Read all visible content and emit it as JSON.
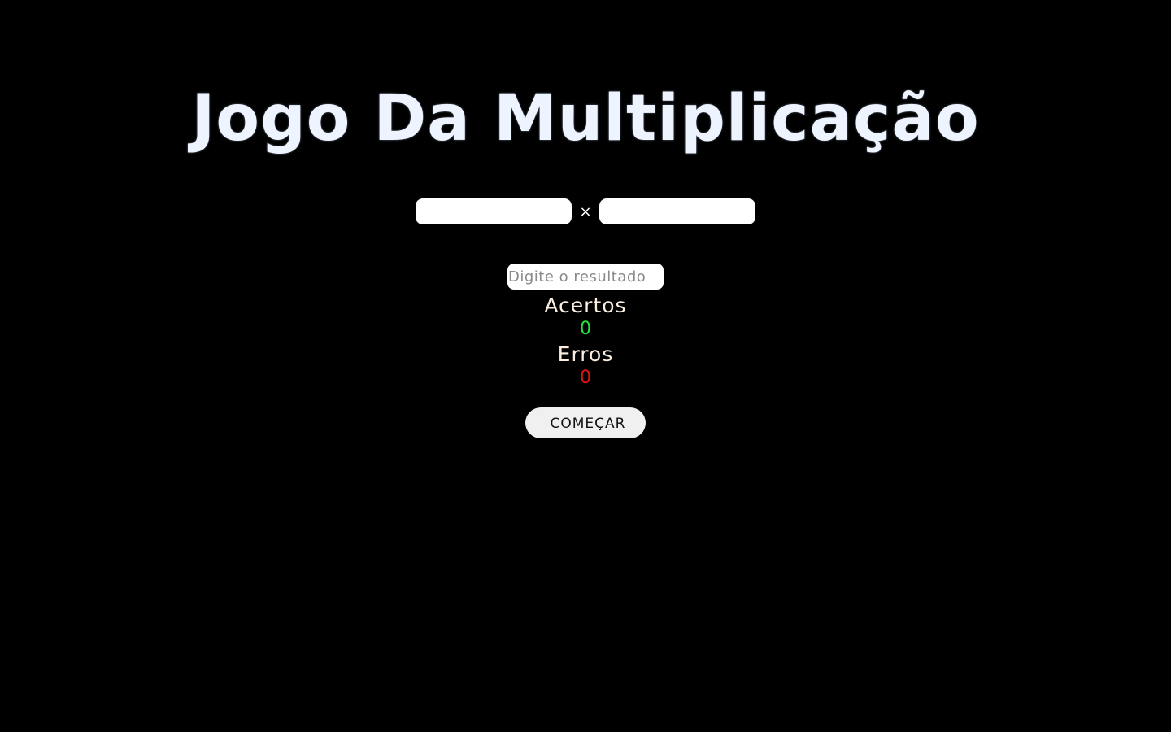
{
  "title": "Jogo Da Multiplicação",
  "operation": {
    "operand_a": "",
    "operator": "×",
    "operand_b": ""
  },
  "answer": {
    "value": "",
    "placeholder": "Digite o resultado"
  },
  "score": {
    "hits_label": "Acertos",
    "hits_value": "0",
    "hits_color": "#22e53a",
    "errors_label": "Erros",
    "errors_value": "0",
    "errors_color": "#e41414"
  },
  "start_button_label": "COMEÇAR"
}
